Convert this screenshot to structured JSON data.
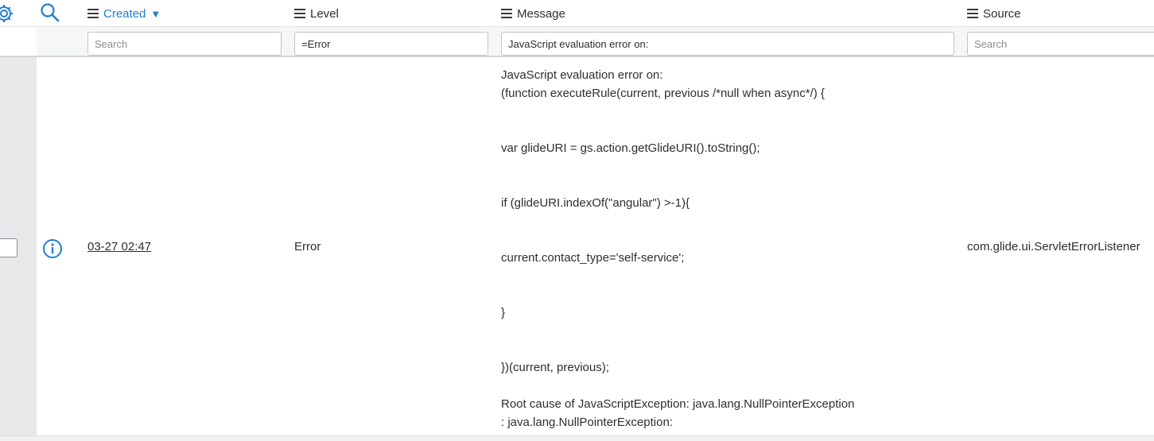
{
  "columns": {
    "created": {
      "label": "Created",
      "sort_indicator": "▼"
    },
    "level": {
      "label": "Level"
    },
    "message": {
      "label": "Message"
    },
    "source": {
      "label": "Source"
    }
  },
  "filters": {
    "created": {
      "value": "",
      "placeholder": "Search"
    },
    "level": {
      "value": "=Error",
      "placeholder": "Search"
    },
    "message": {
      "value": "JavaScript evaluation error on:",
      "placeholder": "Search"
    },
    "source": {
      "value": "",
      "placeholder": "Search"
    }
  },
  "row": {
    "created": "03-27 02:47",
    "level": "Error",
    "source": "com.glide.ui.ServletErrorListener",
    "message_lines": [
      "JavaScript evaluation error on:",
      "(function executeRule(current, previous /*null when async*/) {",
      "",
      "",
      "var glideURI = gs.action.getGlideURI().toString();",
      "",
      "",
      "if (glideURI.indexOf(\"angular\") >-1){",
      "",
      "",
      "current.contact_type='self-service';",
      "",
      "",
      "}",
      "",
      "",
      "})(current, previous);",
      "",
      "Root cause of JavaScriptException: java.lang.NullPointerException",
      ": java.lang.NullPointerException:"
    ]
  },
  "icons": {
    "settings": "gear-icon",
    "search": "search-icon",
    "info": "info-icon",
    "menu": "hamburger-icon"
  },
  "colors": {
    "accent": "#1f7fd0",
    "gutter": "#e6e8ea"
  }
}
